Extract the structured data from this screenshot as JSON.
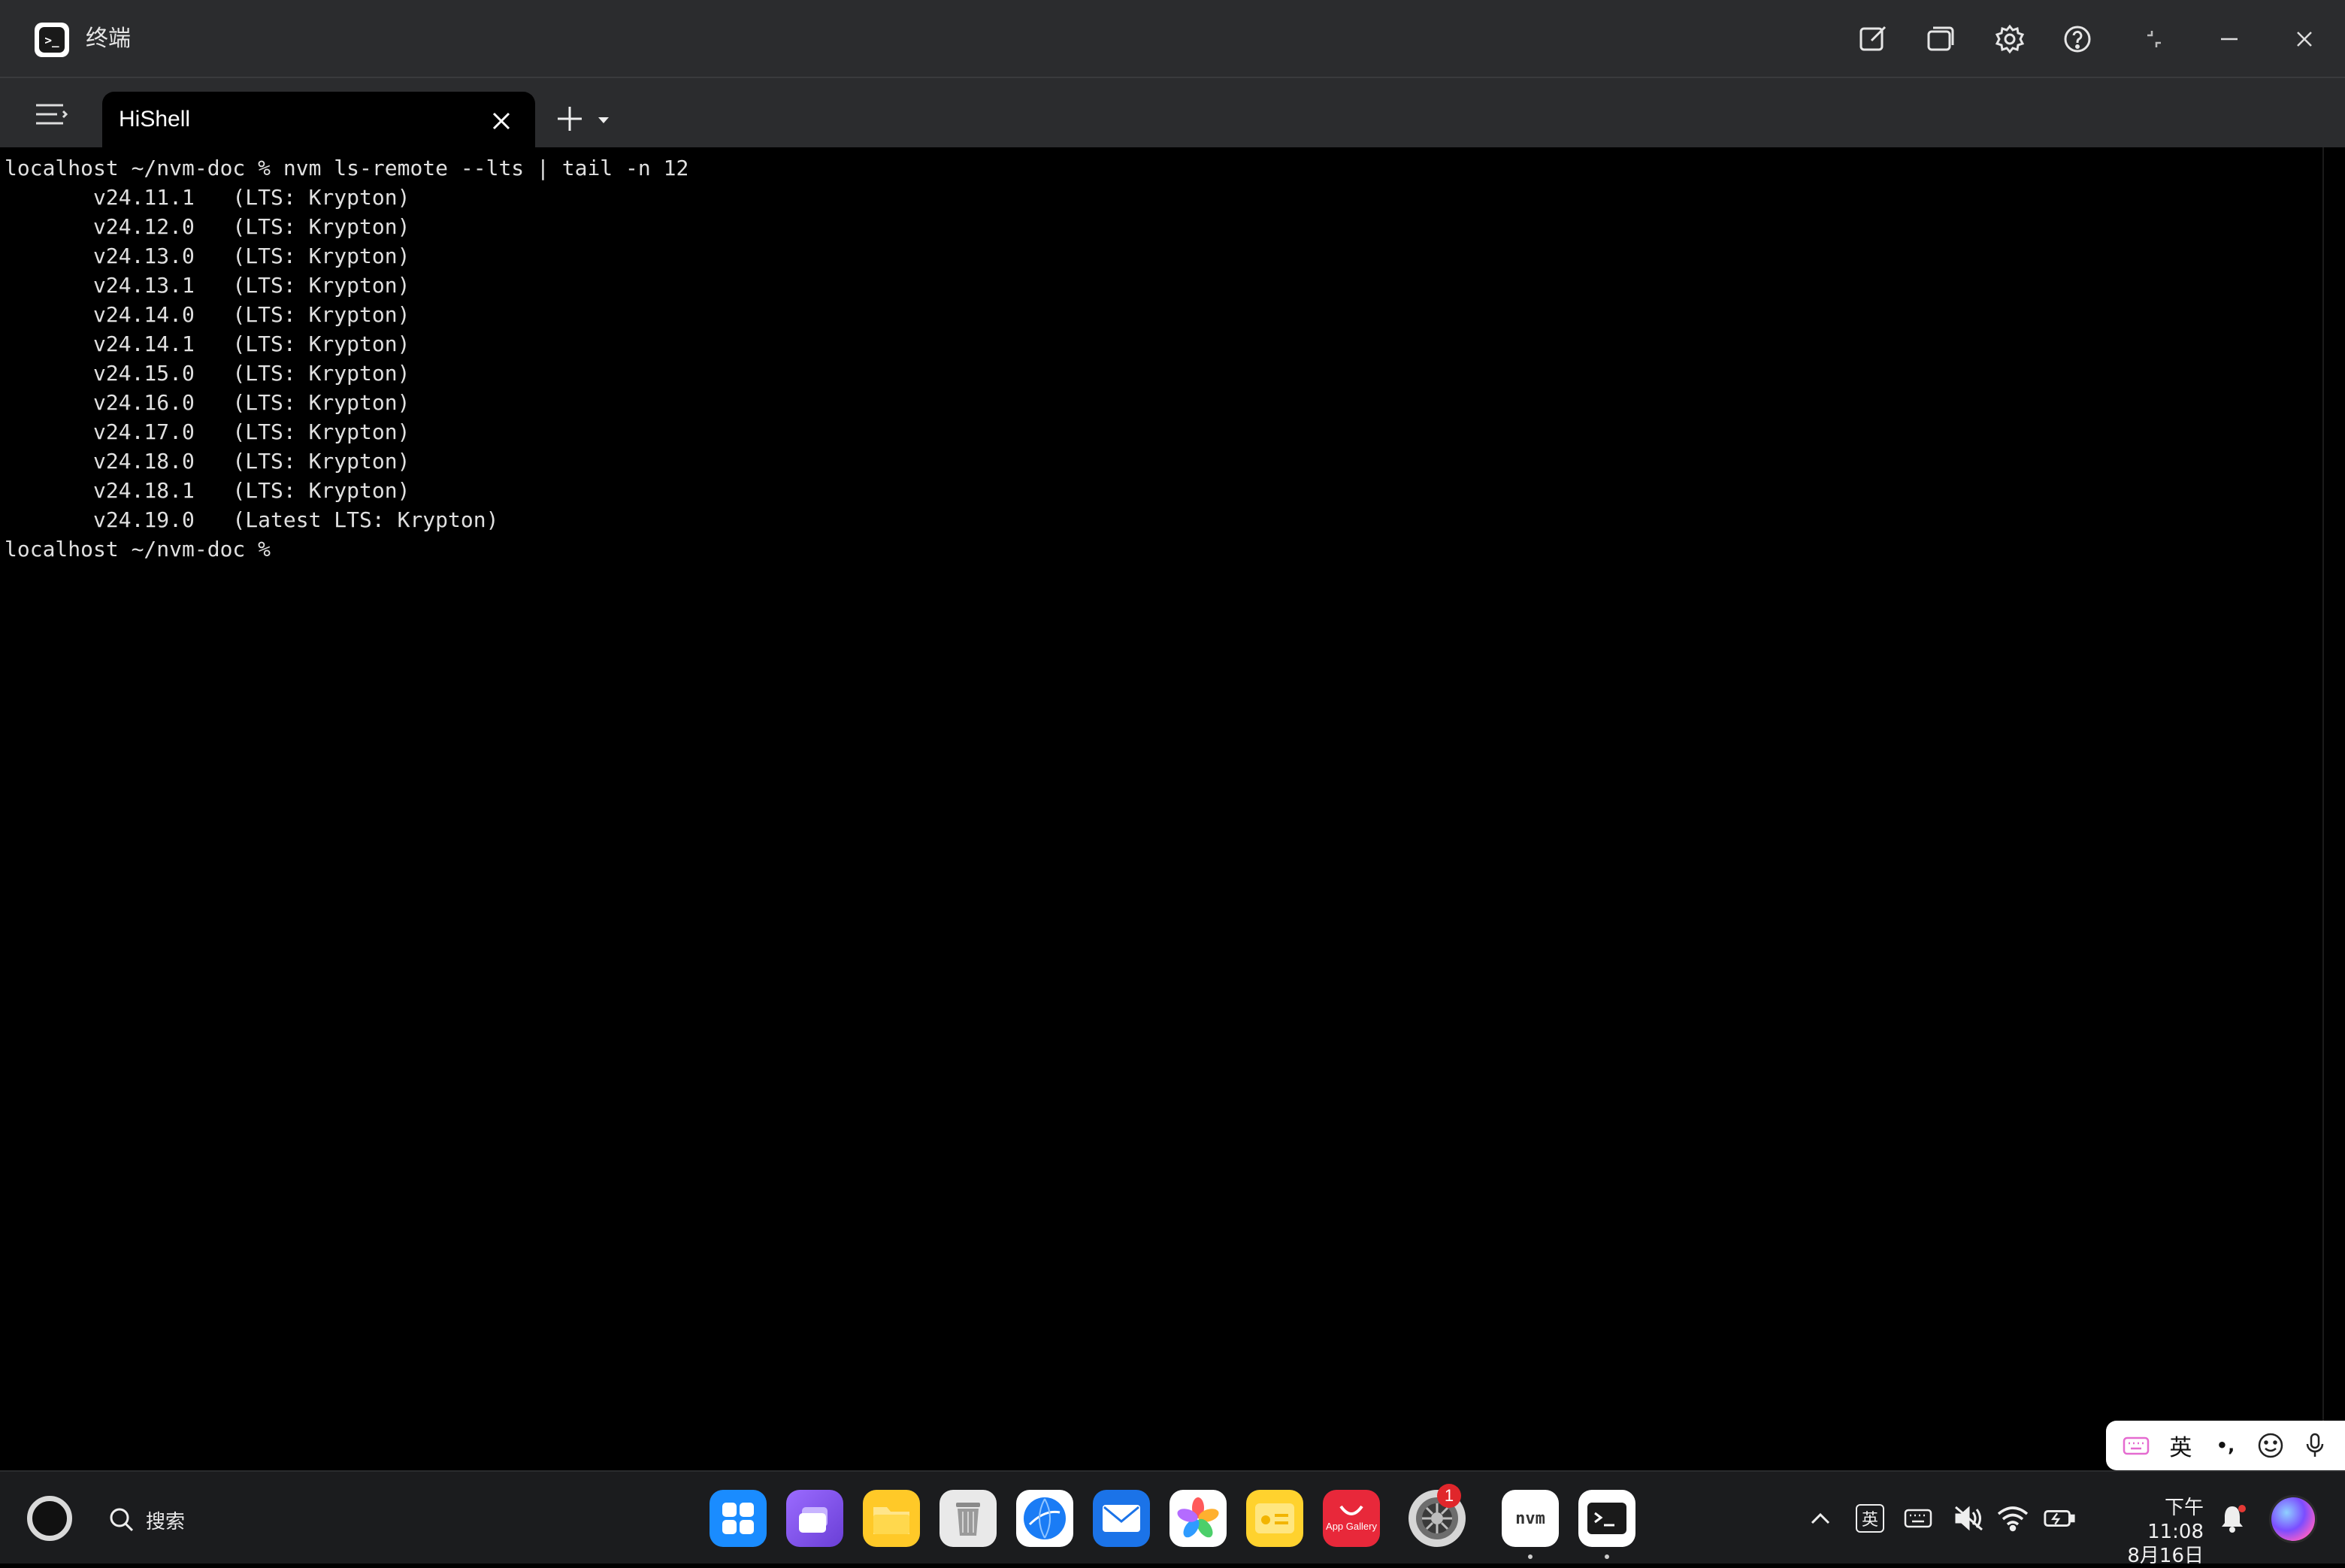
{
  "window": {
    "title": "终端"
  },
  "tabs": [
    {
      "label": "HiShell"
    }
  ],
  "terminal": {
    "lines": [
      "localhost ~/nvm-doc % nvm ls-remote --lts | tail -n 12",
      "       v24.11.1   (LTS: Krypton)",
      "       v24.12.0   (LTS: Krypton)",
      "       v24.13.0   (LTS: Krypton)",
      "       v24.13.1   (LTS: Krypton)",
      "       v24.14.0   (LTS: Krypton)",
      "       v24.14.1   (LTS: Krypton)",
      "       v24.15.0   (LTS: Krypton)",
      "       v24.16.0   (LTS: Krypton)",
      "       v24.17.0   (LTS: Krypton)",
      "       v24.18.0   (LTS: Krypton)",
      "       v24.18.1   (LTS: Krypton)",
      "       v24.19.0   (Latest LTS: Krypton)",
      "localhost ~/nvm-doc %"
    ]
  },
  "ime": {
    "mode_label": "英",
    "punct_label": "•,",
    "colors": {
      "keyboard": "#e56bd0"
    }
  },
  "taskbar": {
    "search_label": "搜索",
    "dock": [
      {
        "icon": "app-center-icon"
      },
      {
        "icon": "multi-window-icon"
      },
      {
        "icon": "files-icon"
      },
      {
        "icon": "trash-icon"
      },
      {
        "icon": "browser-icon"
      },
      {
        "icon": "mail-icon"
      },
      {
        "icon": "photos-icon"
      },
      {
        "icon": "notes-icon"
      },
      {
        "icon": "app-gallery-icon",
        "text": "App Gallery"
      },
      {
        "icon": "settings-icon",
        "badge": "1"
      },
      {
        "icon": "nvm-icon",
        "text": "nvm"
      },
      {
        "icon": "terminal-icon"
      }
    ],
    "tray": {
      "ime_label": "英"
    },
    "clock": {
      "time": "下午11:08",
      "date": "8月16日"
    }
  },
  "colors": {
    "titlebar_bg": "#2b2c2e",
    "terminal_bg": "#000000",
    "terminal_fg": "#e0e0e0",
    "taskbar_bg": "#1b1c1e",
    "badge": "#e0262b"
  }
}
